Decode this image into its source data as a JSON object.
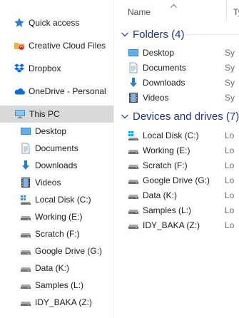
{
  "nav": {
    "items": [
      {
        "label": "Quick access",
        "icon": "star-icon"
      },
      {
        "label": "Creative Cloud Files",
        "icon": "creative-cloud-icon"
      },
      {
        "label": "Dropbox",
        "icon": "dropbox-icon"
      },
      {
        "label": "OneDrive - Personal",
        "icon": "onedrive-icon"
      },
      {
        "label": "This PC",
        "icon": "computer-icon",
        "selected": true
      },
      {
        "label": "Desktop",
        "icon": "desktop-icon"
      },
      {
        "label": "Documents",
        "icon": "documents-icon"
      },
      {
        "label": "Downloads",
        "icon": "downloads-icon"
      },
      {
        "label": "Videos",
        "icon": "videos-icon"
      },
      {
        "label": "Local Disk (C:)",
        "icon": "windows-drive-icon"
      },
      {
        "label": "Working (E:)",
        "icon": "drive-icon"
      },
      {
        "label": "Scratch (F:)",
        "icon": "drive-icon"
      },
      {
        "label": "Google Drive (G:)",
        "icon": "drive-icon"
      },
      {
        "label": "Data (K:)",
        "icon": "drive-icon"
      },
      {
        "label": "Samples (L:)",
        "icon": "drive-icon"
      },
      {
        "label": "IDY_BAKA (Z:)",
        "icon": "drive-icon"
      }
    ]
  },
  "columns": {
    "name": "Name",
    "type_truncated": "Ty"
  },
  "groups": {
    "folders": {
      "title": "Folders (4)",
      "items": [
        {
          "label": "Desktop",
          "icon": "desktop-icon",
          "trunc": "Sy"
        },
        {
          "label": "Documents",
          "icon": "documents-icon",
          "trunc": "Sy"
        },
        {
          "label": "Downloads",
          "icon": "downloads-icon",
          "trunc": "Sy"
        },
        {
          "label": "Videos",
          "icon": "videos-icon",
          "trunc": "Sy"
        }
      ]
    },
    "drives": {
      "title": "Devices and drives (7)",
      "items": [
        {
          "label": "Local Disk (C:)",
          "icon": "windows-drive-icon",
          "trunc": "Lo"
        },
        {
          "label": "Working (E:)",
          "icon": "drive-icon",
          "trunc": "Lo"
        },
        {
          "label": "Scratch (F:)",
          "icon": "drive-icon",
          "trunc": "Lo"
        },
        {
          "label": "Google Drive (G:)",
          "icon": "drive-icon",
          "trunc": "Lo"
        },
        {
          "label": "Data (K:)",
          "icon": "drive-icon",
          "trunc": "Lo"
        },
        {
          "label": "Samples (L:)",
          "icon": "drive-icon",
          "trunc": "Lo"
        },
        {
          "label": "IDY_BAKA (Z:)",
          "icon": "drive-icon",
          "trunc": "Lo"
        }
      ]
    }
  },
  "colors": {
    "group_header": "#1e3287",
    "selection": "#d9d9d9",
    "accent": "#0078d7"
  }
}
